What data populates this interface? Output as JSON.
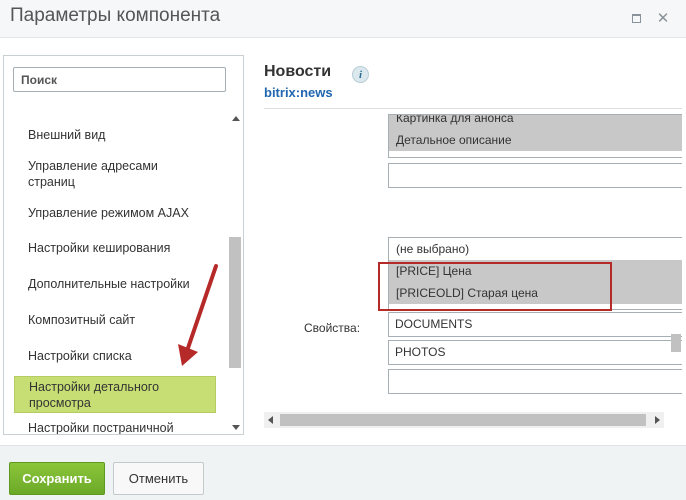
{
  "window": {
    "title": "Параметры компонента"
  },
  "sidebar": {
    "search_placeholder": "Поиск",
    "items": [
      {
        "label": "Внешний вид"
      },
      {
        "label": "Управление адресами страниц"
      },
      {
        "label": "Управление режимом AJAX"
      },
      {
        "label": "Настройки кеширования"
      },
      {
        "label": "Дополнительные настройки"
      },
      {
        "label": "Композитный сайт"
      },
      {
        "label": "Настройки списка"
      },
      {
        "label": "Настройки детального просмотра"
      },
      {
        "label": "Настройки постраничной"
      }
    ],
    "active_index": 7
  },
  "component": {
    "title": "Новости",
    "code": "bitrix:news",
    "info_icon": "info-icon"
  },
  "content": {
    "top_list": {
      "options": [
        "Картинка для анонса",
        "Детальное описание"
      ]
    },
    "props_list": {
      "options": [
        "(не выбрано)",
        "[PRICE] Цена",
        "[PRICEOLD] Старая цена"
      ]
    },
    "properties_label": "Свойства:",
    "property_fields": [
      "DOCUMENTS",
      "PHOTOS",
      ""
    ]
  },
  "footer": {
    "save_label": "Сохранить",
    "cancel_label": "Отменить"
  },
  "colors": {
    "save_button": "#6ca927",
    "active_item": "#c7de74",
    "highlight_border": "#b62929",
    "link": "#2067b0"
  }
}
